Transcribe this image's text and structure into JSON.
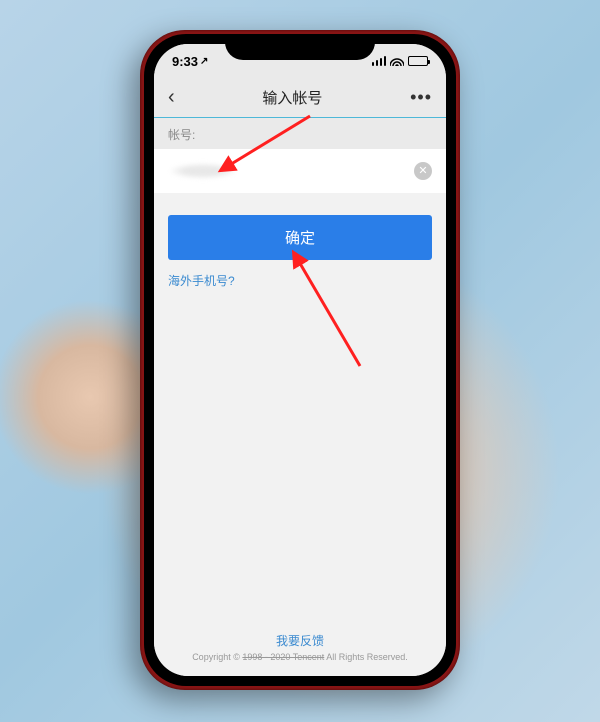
{
  "status": {
    "time": "9:33",
    "time_icon": "↗"
  },
  "nav": {
    "title": "输入帐号",
    "back": "‹",
    "more": "•••"
  },
  "form": {
    "account_label": "帐号:",
    "clear_icon": "✕"
  },
  "actions": {
    "confirm": "确定",
    "overseas": "海外手机号?"
  },
  "footer": {
    "feedback": "我要反馈",
    "copyright_pre": "Copyright © ",
    "copyright_strike": "1998 - 2020 Tencent",
    "copyright_post": " All Rights Reserved."
  }
}
